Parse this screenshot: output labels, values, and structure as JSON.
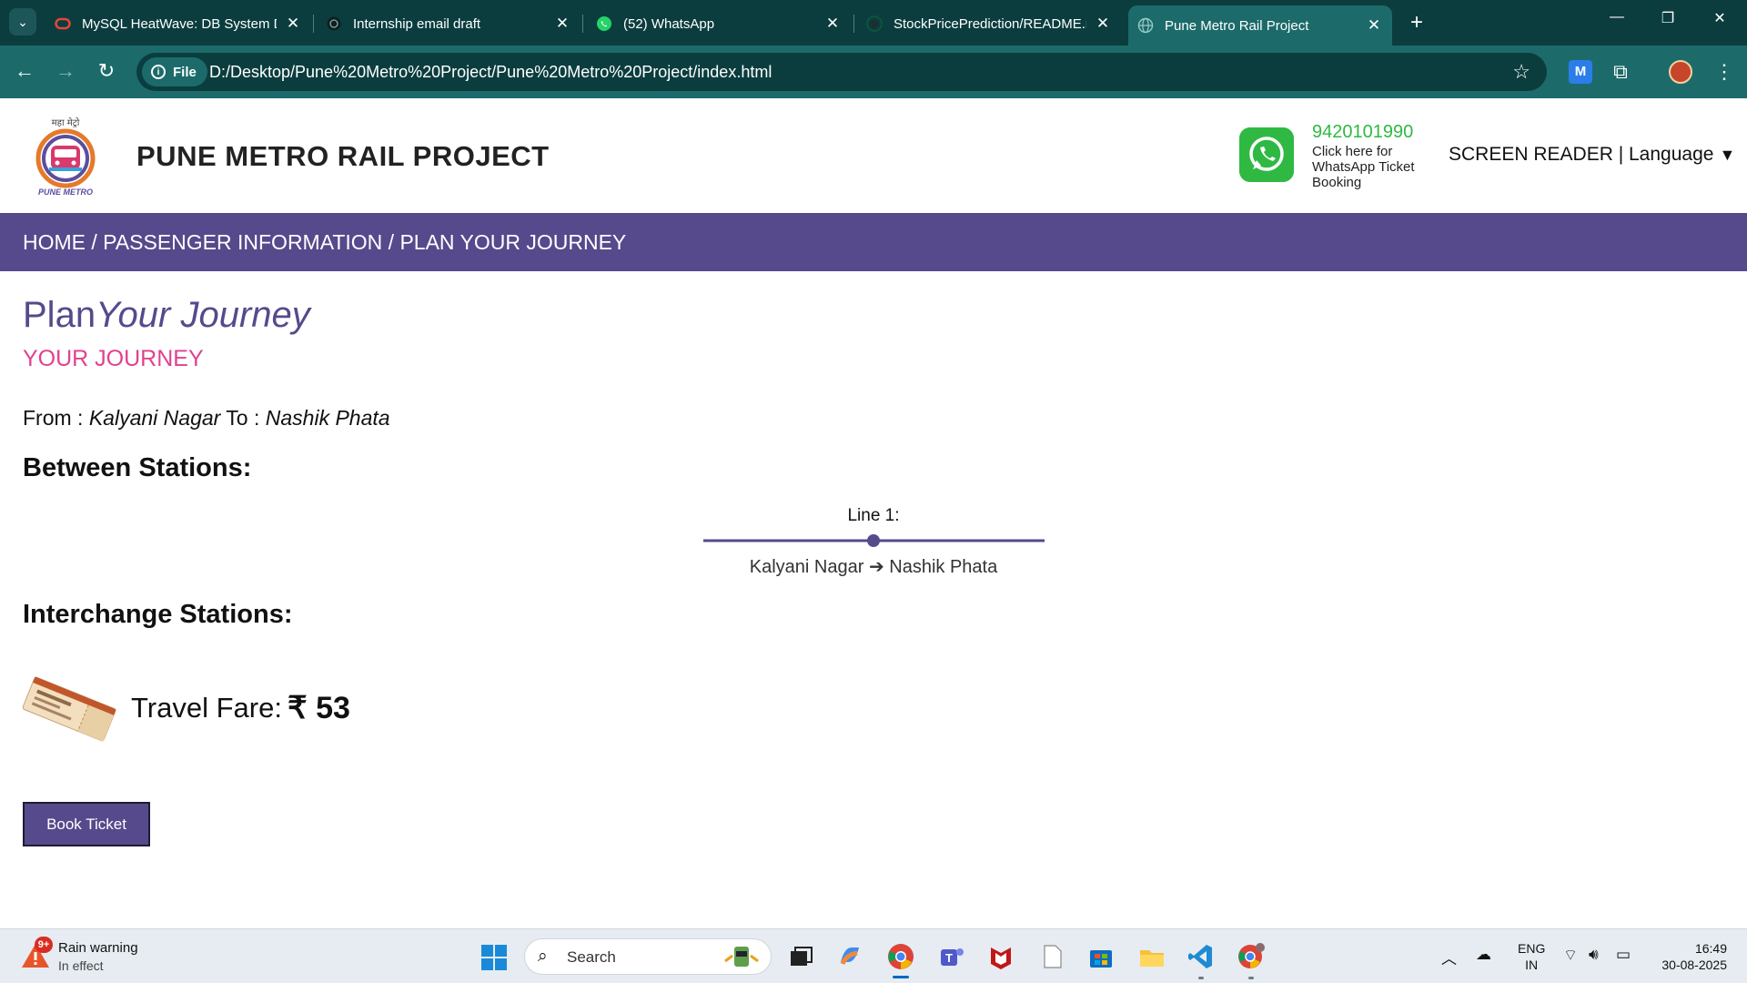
{
  "browser": {
    "tabs": [
      {
        "title": "MySQL HeatWave: DB System D",
        "icon": "oracle-icon",
        "active": false
      },
      {
        "title": "Internship email draft",
        "icon": "chatgpt-icon",
        "active": false
      },
      {
        "title": "(52) WhatsApp",
        "icon": "whatsapp-icon",
        "active": false
      },
      {
        "title": "StockPricePrediction/README.m",
        "icon": "github-icon",
        "active": false
      },
      {
        "title": "Pune Metro Rail Project",
        "icon": "globe-icon",
        "active": true
      }
    ],
    "address": {
      "chip_label": "File",
      "url": "D:/Desktop/Pune%20Metro%20Project/Pune%20Metro%20Project/index.html"
    },
    "colors": {
      "frame": "#0b3d3f",
      "toolbar": "#1c6b6a"
    }
  },
  "site": {
    "title": "PUNE METRO RAIL PROJECT",
    "logo_text": "PUNE METRO",
    "logo_script": "महा मेट्रो",
    "whatsapp": {
      "phone": "9420101990",
      "text": "Click here for WhatsApp Ticket Booking"
    },
    "header_right": {
      "label": "SCREEN READER | Language",
      "caret": "▼"
    },
    "breadcrumb": "HOME / PASSENGER INFORMATION / PLAN YOUR JOURNEY",
    "colors": {
      "primary": "#564a8c",
      "accent_pink": "#e2418f",
      "whatsapp_green": "#2fb943"
    }
  },
  "journey": {
    "title_plain": "Plan",
    "title_em": "Your Journey",
    "subtitle": "YOUR JOURNEY",
    "from_label": "From :",
    "from_station": "Kalyani Nagar",
    "to_label": "To :",
    "to_station": "Nashik Phata",
    "between_heading": "Between Stations:",
    "line_label": "Line 1:",
    "line_route": "Kalyani Nagar ➔ Nashik Phata",
    "interchange_heading": "Interchange Stations:",
    "fare_label": "Travel Fare:",
    "fare_value": "₹ 53",
    "book_button": "Book Ticket"
  },
  "taskbar": {
    "weather": {
      "badge": "9+",
      "title": "Rain warning",
      "subtitle": "In effect"
    },
    "search_placeholder": "Search",
    "apps": [
      "windows-start",
      "task-view",
      "copilot",
      "chrome",
      "teams",
      "mcafee",
      "notepad",
      "microsoft-store",
      "file-explorer",
      "vscode",
      "chrome-profile"
    ],
    "lang_top": "ENG",
    "lang_bottom": "IN",
    "time": "16:49",
    "date": "30-08-2025"
  }
}
